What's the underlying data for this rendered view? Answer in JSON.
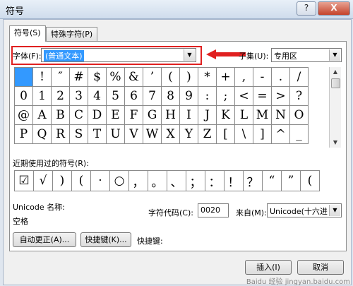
{
  "window": {
    "title": "符号",
    "help_label": "?",
    "close_label": "X"
  },
  "tabs": [
    {
      "label": "符号(S)"
    },
    {
      "label": "特殊字符(P)"
    }
  ],
  "font": {
    "label": "字体(F):",
    "value": "(普通文本)"
  },
  "subset": {
    "label": "子集(U):",
    "value": "专用区"
  },
  "symbols_grid": [
    [
      " ",
      "!",
      "″",
      "#",
      "$",
      "%",
      "&",
      "’",
      "(",
      ")",
      "*",
      "+",
      ",",
      "-",
      ".",
      "/"
    ],
    [
      "0",
      "1",
      "2",
      "3",
      "4",
      "5",
      "6",
      "7",
      "8",
      "9",
      ":",
      ";",
      "<",
      "=",
      ">",
      "?"
    ],
    [
      "@",
      "A",
      "B",
      "C",
      "D",
      "E",
      "F",
      "G",
      "H",
      "I",
      "J",
      "K",
      "L",
      "M",
      "N",
      "O"
    ],
    [
      "P",
      "Q",
      "R",
      "S",
      "T",
      "U",
      "V",
      "W",
      "X",
      "Y",
      "Z",
      "[",
      "\\",
      "]",
      "^",
      "_"
    ]
  ],
  "recent": {
    "label": "近期使用过的符号(R):",
    "symbols": [
      "☑",
      "√",
      ")",
      "(",
      "·",
      "○",
      "，",
      "。",
      "、",
      "；",
      "：",
      "！",
      "？",
      "“",
      "”",
      "("
    ]
  },
  "unicode": {
    "name_label": "Unicode 名称:",
    "char_name": "空格"
  },
  "charcode": {
    "label": "字符代码(C):",
    "value": "0020"
  },
  "from": {
    "label": "来自(M):",
    "value": "Unicode(十六进"
  },
  "buttons": {
    "autocorrect": "自动更正(A)...",
    "shortcut": "快捷键(K)...",
    "shortcut_key_label": "快捷键:",
    "insert": "插入(I)",
    "cancel": "取消"
  },
  "watermark": "Baidu 经验  jingyan.baidu.com",
  "colors": {
    "selection": "#3399ff",
    "highlight_box": "#e02020"
  }
}
